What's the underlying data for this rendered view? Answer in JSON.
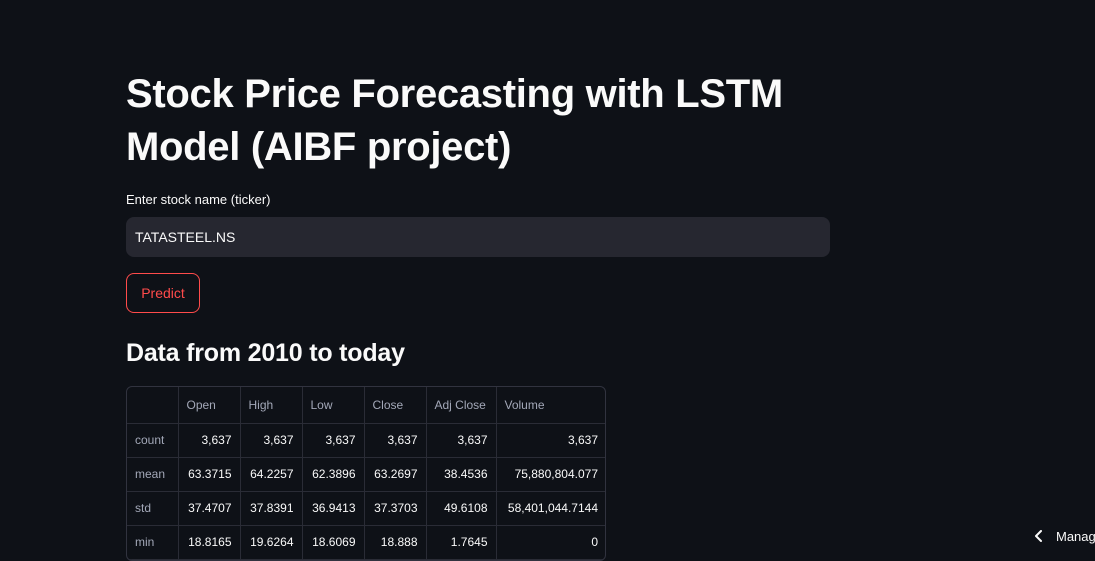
{
  "header": {
    "title": "Stock Price Forecasting with LSTM Model (AIBF project)"
  },
  "form": {
    "input_label": "Enter stock name (ticker)",
    "input_value": "TATASTEEL.NS",
    "predict_label": "Predict"
  },
  "section": {
    "title": "Data from 2010 to today"
  },
  "table": {
    "columns": [
      "",
      "Open",
      "High",
      "Low",
      "Close",
      "Adj Close",
      "Volume"
    ],
    "rows": [
      {
        "label": "count",
        "values": [
          "3,637",
          "3,637",
          "3,637",
          "3,637",
          "3,637",
          "3,637"
        ]
      },
      {
        "label": "mean",
        "values": [
          "63.3715",
          "64.2257",
          "62.3896",
          "63.2697",
          "38.4536",
          "75,880,804.077"
        ]
      },
      {
        "label": "std",
        "values": [
          "37.4707",
          "37.8391",
          "36.9413",
          "37.3703",
          "49.6108",
          "58,401,044.7144"
        ]
      },
      {
        "label": "min",
        "values": [
          "18.8165",
          "19.6264",
          "18.6069",
          "18.888",
          "1.7645",
          "0"
        ]
      }
    ]
  },
  "manage": {
    "label": "Manage app",
    "icon": "chevron-left-icon"
  },
  "colors": {
    "background": "#0e1117",
    "input_bg": "#262730",
    "accent": "#ff4b4b"
  }
}
